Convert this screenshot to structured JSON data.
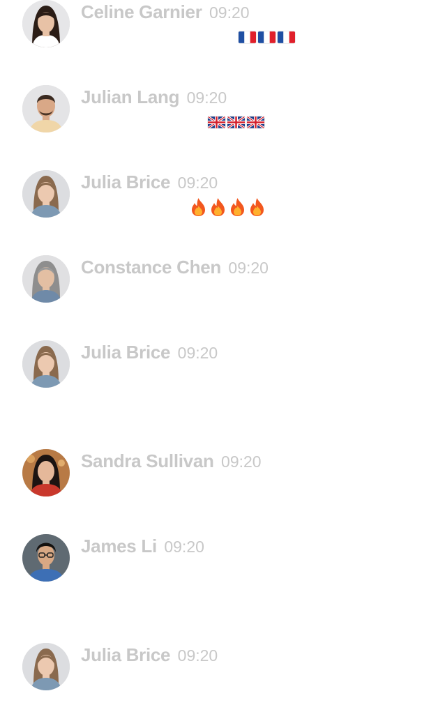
{
  "messages": [
    {
      "name": "Celine Garnier",
      "time": "09:20",
      "avatar": "avatar-woman-dark-hair",
      "reactions": [
        "flag-fr-icon",
        "flag-fr-icon",
        "flag-fr-icon"
      ]
    },
    {
      "name": "Julian Lang",
      "time": "09:20",
      "avatar": "avatar-man-short-hair",
      "reactions": [
        "flag-gb-icon",
        "flag-gb-icon",
        "flag-gb-icon"
      ]
    },
    {
      "name": "Julia Brice",
      "time": "09:20",
      "avatar": "avatar-woman-light-hair",
      "reactions": [
        "fire-icon",
        "fire-icon",
        "fire-icon",
        "fire-icon"
      ]
    },
    {
      "name": "Constance Chen",
      "time": "09:20",
      "avatar": "avatar-woman-gray-hair",
      "reactions": []
    },
    {
      "name": "Julia Brice",
      "time": "09:20",
      "avatar": "avatar-woman-light-hair",
      "reactions": []
    },
    {
      "name": "Sandra Sullivan",
      "time": "09:20",
      "avatar": "avatar-woman-red-top",
      "reactions": []
    },
    {
      "name": "James Li",
      "time": "09:20",
      "avatar": "avatar-man-glasses",
      "reactions": []
    },
    {
      "name": "Julia Brice",
      "time": "09:20",
      "avatar": "avatar-woman-light-hair",
      "reactions": []
    }
  ],
  "colors": {
    "text_muted": "#c8c8c8",
    "background": "#ffffff"
  }
}
